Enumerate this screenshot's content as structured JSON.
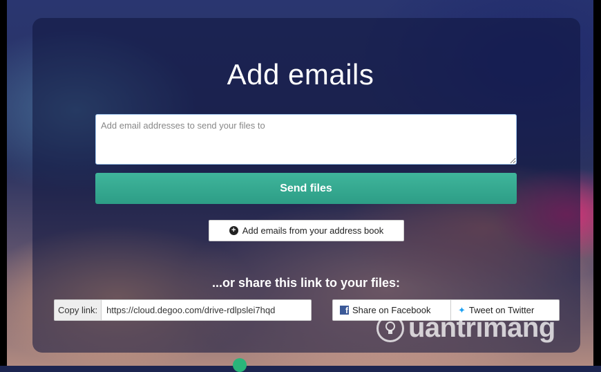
{
  "title": "Add emails",
  "email_input": {
    "placeholder": "Add email addresses to send your files to",
    "value": ""
  },
  "send_button": {
    "label": "Send files"
  },
  "address_book_button": {
    "label": "Add emails from your address book",
    "icon": "plus-circle-icon"
  },
  "share": {
    "heading": "...or share this link to your files:",
    "copy_label": "Copy link:",
    "link_value": "https://cloud.degoo.com/drive-rdlpslei7hqd",
    "facebook_label": "Share on Facebook",
    "twitter_label": "Tweet on Twitter"
  },
  "watermark": {
    "text": "uantrimang",
    "icon": "lightbulb-icon"
  },
  "colors": {
    "accent": "#33a88f",
    "facebook": "#3b5998",
    "twitter": "#1da1f2"
  }
}
